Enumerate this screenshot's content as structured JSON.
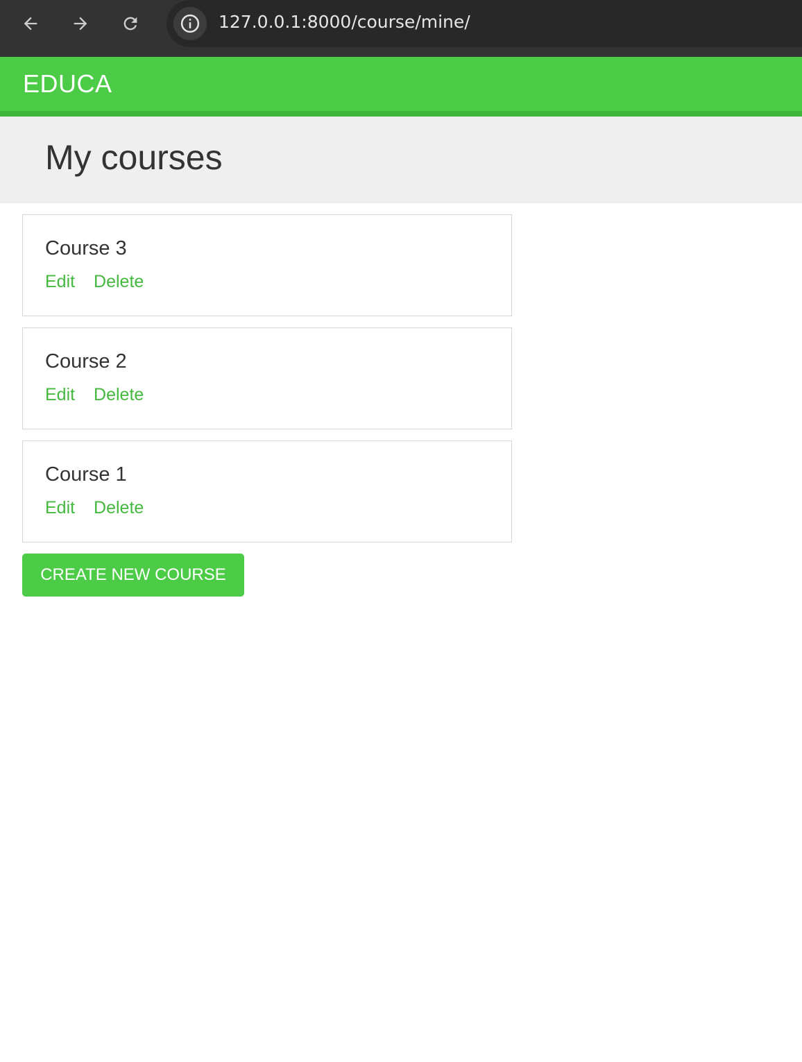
{
  "browser": {
    "url": "127.0.0.1:8000/course/mine/",
    "icons": {
      "back": "arrow-left-icon",
      "forward": "arrow-right-icon",
      "reload": "reload-icon",
      "site_info": "info-icon"
    },
    "colors": {
      "toolbar": "#333333",
      "address_bar": "#282828",
      "icon": "#cfcfcf"
    }
  },
  "header": {
    "logo": "EDUCA",
    "color": "#4ccc46"
  },
  "page": {
    "title": "My courses"
  },
  "courses": [
    {
      "title": "Course 3",
      "edit_label": "Edit",
      "delete_label": "Delete"
    },
    {
      "title": "Course 2",
      "edit_label": "Edit",
      "delete_label": "Delete"
    },
    {
      "title": "Course 1",
      "edit_label": "Edit",
      "delete_label": "Delete"
    }
  ],
  "actions": {
    "create_label": "CREATE NEW COURSE"
  },
  "colors": {
    "accent": "#4ccc46",
    "link": "#45b83f",
    "title_band": "#efefef"
  }
}
